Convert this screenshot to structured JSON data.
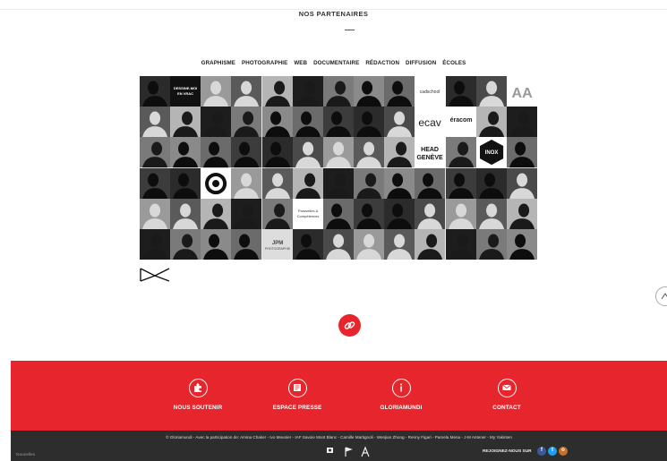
{
  "header": {
    "title": "NOS PARTENAIRES"
  },
  "filters": [
    "GRAPHISME",
    "PHOTOGRAPHIE",
    "WEB",
    "DOCUMENTAIRE",
    "RÉDACTION",
    "DIFFUSION",
    "ÉCOLES"
  ],
  "logo_text": {
    "blackbox": "DESSINE-MOI\nEN VRAC",
    "cadschool": "cadschool",
    "aa": "AA",
    "ecav": "ecav",
    "eracom": "éracom",
    "head": "HEAD\nGENÈVE",
    "inox": "INOX",
    "paravelles": "Paravelles &\nCompétences",
    "jpm": "JPM\nPHOTOGRAPHIE"
  },
  "footer": {
    "items": [
      {
        "label": "NOUS SOUTENIR",
        "icon": "puzzle-icon"
      },
      {
        "label": "ESPACE PRESSE",
        "icon": "newspaper-icon"
      },
      {
        "label": "GLORIAMUNDI",
        "icon": "info-icon"
      },
      {
        "label": "CONTACT",
        "icon": "envelope-icon"
      }
    ],
    "credits": "© Gloriamundi - Avec la participation de: Amina Chaker - Ivo Meunier - IAF Savoie Mont Blanc - Camille Martignoli - Wenjian Zhong - Renny Figari - Pamela Mena - J-M Antener - My Yakinten",
    "social_label": "REJOIGNEZ-NOUS SUR",
    "social": [
      "facebook",
      "twitter",
      "instagram"
    ],
    "corner": "Nouvelles"
  },
  "colors": {
    "accent": "#e6262c",
    "dark": "#2d2d2d"
  }
}
